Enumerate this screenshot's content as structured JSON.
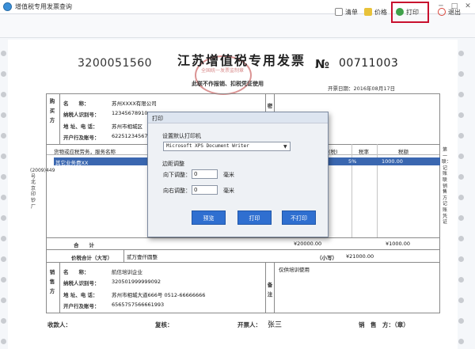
{
  "window": {
    "title": "增值税专用发票查询"
  },
  "toolbar": {
    "clear": "清单",
    "price": "价格",
    "print": "打印",
    "exit": "退出"
  },
  "invoice": {
    "code": "3200051560",
    "title": "江苏增值税专用发票",
    "no_symbol": "№",
    "number": "00711003",
    "subtitle": "此联不作报销、扣税凭证使用",
    "issue_date": "开票日期：2016年08月17日",
    "buyer": {
      "section": "购买方",
      "name_label": "名　　称：",
      "name": "苏州XXXX有限公司",
      "tax_label": "纳税人识别号：",
      "tax_id": "12345678910",
      "addr_label": "地 址、电 话：",
      "addr": "苏州市相城区",
      "bank_label": "开户行及账号：",
      "bank": "622512345678"
    },
    "password_area_label": "密",
    "headers": {
      "goods": "货物或应税劳务，服务名称",
      "tax_rate_paren": "(税)",
      "rate": "税率",
      "tax": "税额"
    },
    "item": {
      "name": "其它业务费XX",
      "rate": "5%",
      "tax": "1000.00"
    },
    "left_side": "(2009)449号北京印钞厂",
    "right_side": "第一联：记账联　销售方记账凭证",
    "totals": {
      "label": "合　　计",
      "amount": "¥20000.00",
      "tax": "¥1000.00"
    },
    "total_in_words_label": "价税合计（大写）",
    "total_in_words": "贰万壹仟圆整",
    "total_small_label": "（小写）",
    "total_small": "¥21000.00",
    "seller": {
      "section": "销售方",
      "name_label": "名　　称：",
      "name": "航信培训企业",
      "tax_label": "纳税人识别号：",
      "tax_id": "320501999999092",
      "addr_label": "地 址、电 话：",
      "addr": "苏州市相城大道666号 0512-66666666",
      "bank_label": "开户行及账号：",
      "bank": "6565757566661993"
    },
    "remarks_label": "备注",
    "remarks": "仅供培训使用",
    "footer": {
      "payee": "收款人：",
      "reviewer": "复核：",
      "drawer_label": "开票人：",
      "drawer": "张三",
      "seller_seal": "销　售　方：（章）"
    }
  },
  "print_dialog": {
    "title": "打印",
    "printer_label": "设置默认打印机",
    "printer_selected": "Microsoft XPS Document Writer",
    "margin_label": "边距调整",
    "down_label": "向下调整：",
    "down_value": "0",
    "right_label": "向右调整：",
    "right_value": "0",
    "unit": "毫米",
    "preview": "预览",
    "print": "打印",
    "no_print": "不打印"
  }
}
